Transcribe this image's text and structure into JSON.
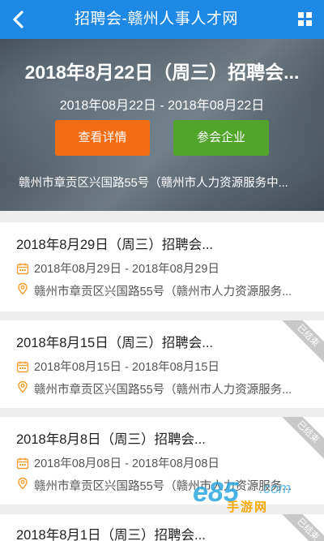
{
  "header": {
    "title": "招聘会-赣州人事人才网"
  },
  "featured": {
    "title": "2018年8月22日（周三）招聘会...",
    "date_range": "2018年08月22日 - 2018年08月22日",
    "detail_button": "查看详情",
    "company_button": "参会企业",
    "address": "赣州市章贡区兴国路55号（赣州市人力资源服务中..."
  },
  "events": [
    {
      "title": "2018年8月29日（周三）招聘会...",
      "date_range": "2018年08月29日 - 2018年08月29日",
      "address": "赣州市章贡区兴国路55号（赣州市人力资源服务...",
      "status": ""
    },
    {
      "title": "2018年8月15日（周三）招聘会...",
      "date_range": "2018年08月15日 - 2018年08月15日",
      "address": "赣州市章贡区兴国路55号（赣州市人力资源服务...",
      "status": "已结束"
    },
    {
      "title": "2018年8月8日（周三）招聘会...",
      "date_range": "2018年08月08日 - 2018年08月08日",
      "address": "赣州市章贡区兴国路55号（赣州市人力资源服务...",
      "status": "已结束"
    },
    {
      "title": "2018年8月1日（周三）招聘会...",
      "date_range": "",
      "address": "",
      "status": "已结束"
    }
  ],
  "watermark": {
    "text": "手游网"
  },
  "colors": {
    "header_bg": "#1e88e5",
    "detail_button": "#f26d12",
    "company_button": "#52a52b",
    "icon_accent": "#f0a030",
    "ended_ribbon": "#c8c8c8"
  }
}
